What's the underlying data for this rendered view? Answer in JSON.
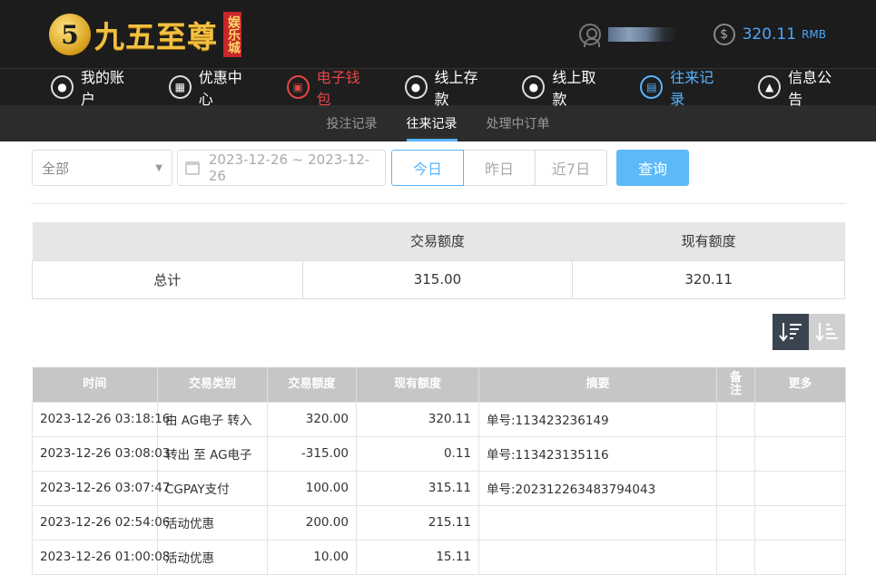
{
  "header": {
    "logo_mark": "5",
    "logo_text": "九五至尊",
    "logo_sub": "娱乐城",
    "balance": "320.11",
    "currency": "RMB"
  },
  "nav": {
    "items": [
      {
        "label": "我的账户",
        "icon": "user-icon"
      },
      {
        "label": "优惠中心",
        "icon": "gift-icon"
      },
      {
        "label": "电子钱包",
        "icon": "wallet-icon"
      },
      {
        "label": "线上存款",
        "icon": "deposit-icon"
      },
      {
        "label": "线上取款",
        "icon": "withdraw-icon"
      },
      {
        "label": "往来记录",
        "icon": "records-icon"
      },
      {
        "label": "信息公告",
        "icon": "bell-icon"
      }
    ]
  },
  "subnav": {
    "items": [
      {
        "label": "投注记录"
      },
      {
        "label": "往来记录"
      },
      {
        "label": "处理中订单"
      }
    ]
  },
  "filters": {
    "type_select": "全部",
    "date_range": "2023-12-26 ~ 2023-12-26",
    "quick": [
      "今日",
      "昨日",
      "近7日"
    ],
    "search_label": "查询"
  },
  "summary": {
    "headers": [
      "",
      "交易额度",
      "现有额度"
    ],
    "row": [
      "总计",
      "315.00",
      "320.11"
    ]
  },
  "records": {
    "headers": [
      "时间",
      "交易类别",
      "交易额度",
      "现有额度",
      "摘要",
      "备注",
      "更多"
    ],
    "rows": [
      [
        "2023-12-26 03:18:16",
        "由 AG电子 转入",
        "320.00",
        "320.11",
        "单号:113423236149",
        "",
        ""
      ],
      [
        "2023-12-26 03:08:03",
        "转出 至 AG电子",
        "-315.00",
        "0.11",
        "单号:113423135116",
        "",
        ""
      ],
      [
        "2023-12-26 03:07:47",
        "CGPAY支付",
        "100.00",
        "315.11",
        "单号:202312263483794043",
        "",
        ""
      ],
      [
        "2023-12-26 02:54:06",
        "活动优惠",
        "200.00",
        "215.11",
        "",
        "",
        ""
      ],
      [
        "2023-12-26 01:00:08",
        "活动优惠",
        "10.00",
        "15.11",
        "",
        "",
        ""
      ]
    ]
  },
  "colors": {
    "accent_blue": "#58b4ff",
    "accent_red": "#e84545",
    "gold": "#f1c042"
  }
}
